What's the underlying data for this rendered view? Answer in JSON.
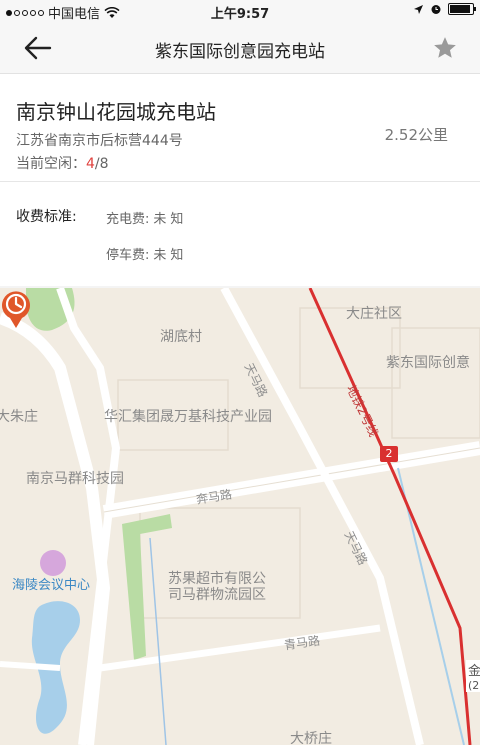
{
  "status": {
    "carrier": "中国电信",
    "time": "上午9:57",
    "signal_bars_filled": 1,
    "signal_bars_total": 5,
    "battery_level": 0.9
  },
  "nav": {
    "title": "紫东国际创意园充电站",
    "back_icon": "back-arrow-icon",
    "favorite_icon": "star-icon"
  },
  "station": {
    "name": "南京钟山花园城充电站",
    "address": "江苏省南京市后标营444号",
    "available_label": "当前空闲：",
    "available_now": "4",
    "available_total": "/8",
    "distance": "2.52公里"
  },
  "fees": {
    "label": "收费标准:",
    "charge_label": "充电费:",
    "charge_value": "未知",
    "parking_label": "停车费:",
    "parking_value": "未知"
  },
  "map": {
    "labels": {
      "dazhuang": "大庄社区",
      "hudicun": "湖底村",
      "zidong": "紫东国际创意",
      "tianmalu_1": "天马路",
      "metro": "地铁2号线",
      "dazhuzhuang": "大朱庄",
      "huahui": "华汇集团晟万基科技产业园",
      "maqun": "南京马群科技园",
      "benmalu": "奔马路",
      "tianmalu_2": "天马路",
      "suguo_1": "苏果超市有限公",
      "suguo_2": "司马群物流园区",
      "hailing": "海陵会议中心",
      "qingmalu": "青马路",
      "daqiao": "大桥庄",
      "metro_badge": "2",
      "edge_station": "金",
      "edge_sub": "(2"
    },
    "colors": {
      "land": "#f2ece2",
      "road": "#ffffff",
      "park": "#b9dca4",
      "water": "#a7cfea",
      "metro": "#d93030",
      "pin": "#e0572a"
    }
  }
}
